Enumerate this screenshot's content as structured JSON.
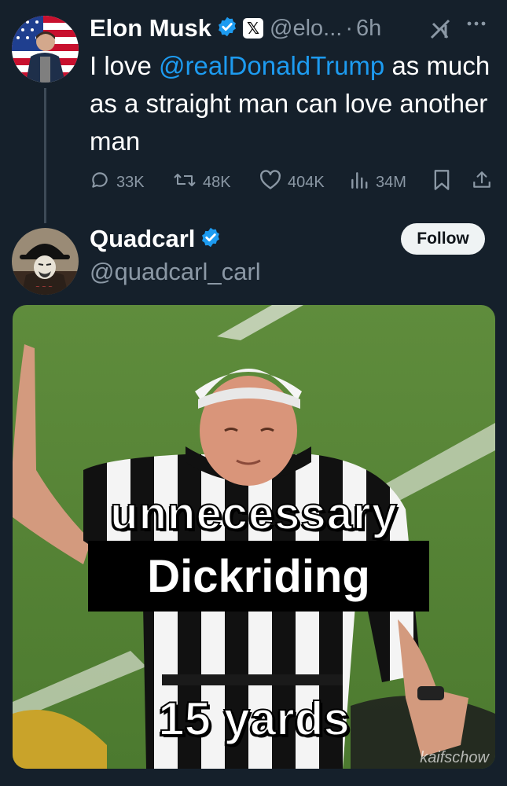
{
  "tweet": {
    "author_name": "Elon Musk",
    "handle": "@elo...",
    "separator": "·",
    "time": "6h",
    "text_before": "I love ",
    "mention": "@realDonaldTrump",
    "text_after": " as much as a straight man can love another man",
    "stats": {
      "replies": "33K",
      "reposts": "48K",
      "likes": "404K",
      "views": "34M"
    }
  },
  "reply": {
    "author_name": "Quadcarl",
    "handle": "@quadcarl_carl",
    "follow_label": "Follow",
    "media": {
      "caption_line1": "unnecessary",
      "caption_line2": "Dickriding",
      "caption_line3": "15 yards",
      "watermark": "kaifschow"
    }
  },
  "icons": {
    "verified": "verified-badge-icon",
    "x_affiliate": "x-logo-icon",
    "grok": "grok-icon",
    "more": "more-icon",
    "reply": "reply-icon",
    "repost": "repost-icon",
    "like": "heart-icon",
    "views": "views-icon",
    "bookmark": "bookmark-icon",
    "share": "share-icon"
  },
  "colors": {
    "background": "#15202b",
    "accent": "#1d9bf0",
    "muted": "#8b98a5"
  }
}
